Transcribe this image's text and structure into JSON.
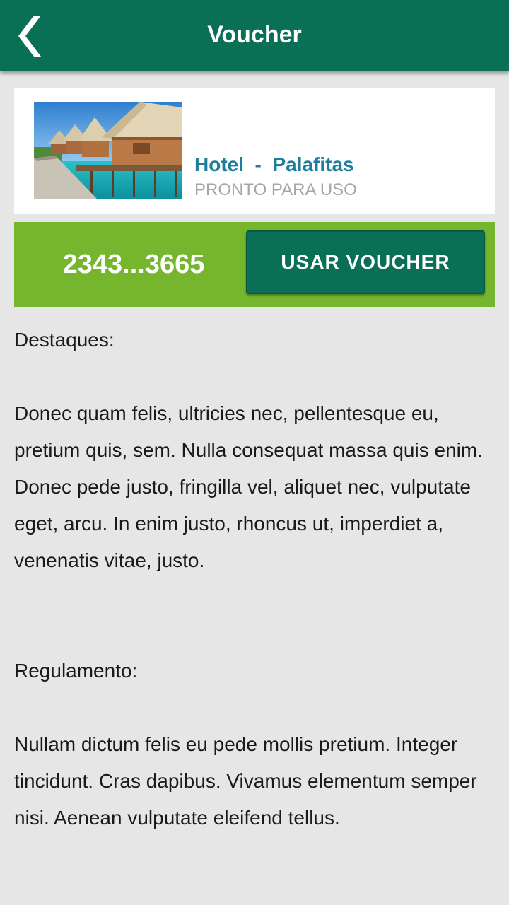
{
  "topbar": {
    "title": "Voucher",
    "back_icon": "chevron-left-icon"
  },
  "offer": {
    "image": "overwater-bungalows-photo",
    "name": "Hotel  -  Palafitas",
    "status": "PRONTO PARA USO"
  },
  "voucher": {
    "code": "2343...3665",
    "use_label": "USAR  VOUCHER"
  },
  "highlights": {
    "heading": "Destaques:",
    "body": "Donec quam felis, ultricies nec, pellentesque eu, pretium quis, sem. Nulla consequat massa quis enim. Donec pede justo, fringilla vel, aliquet nec, vulputate eget, arcu. In enim justo, rhoncus ut, imperdiet a, venenatis vitae, justo."
  },
  "rules": {
    "heading": "Regulamento:",
    "body": "Nullam dictum felis eu pede mollis pretium. Integer tincidunt. Cras dapibus. Vivamus elementum semper nisi. Aenean vulputate eleifend tellus."
  },
  "colors": {
    "header": "#0a7055",
    "accent_green": "#76b52e",
    "hotel_name": "#1e7d9c",
    "background": "#e6e6e6"
  }
}
